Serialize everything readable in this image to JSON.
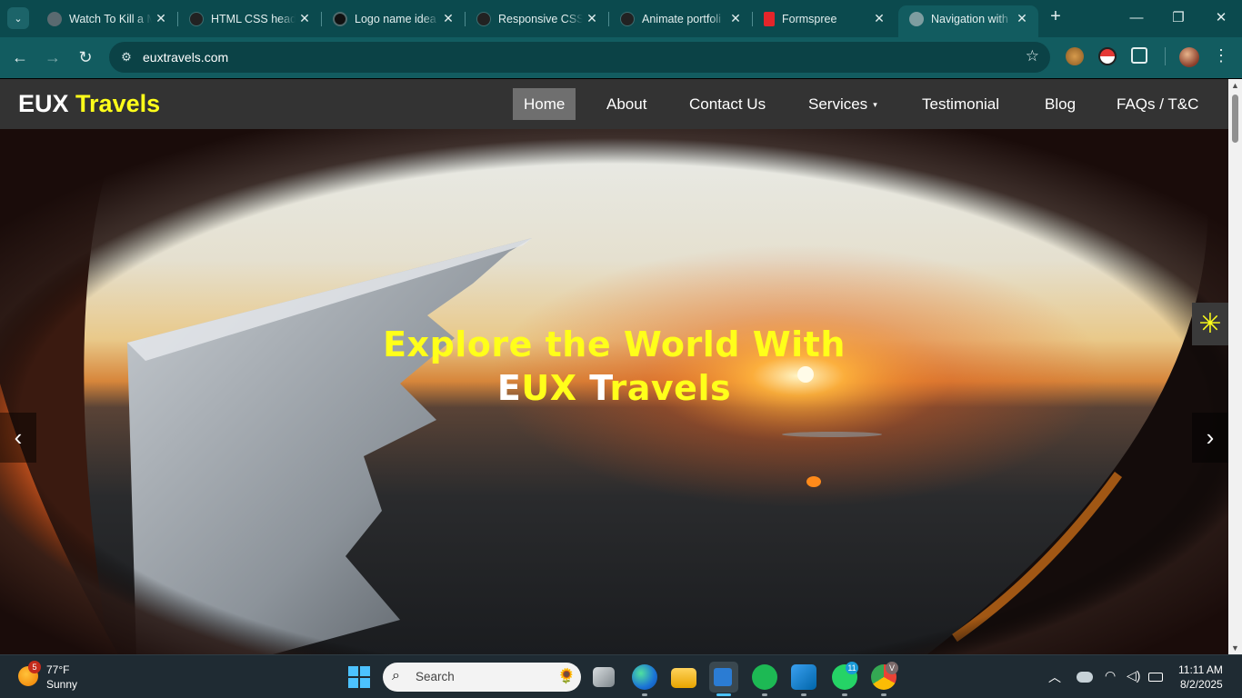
{
  "browser": {
    "tabs": [
      {
        "title": "Watch To Kill a M",
        "favicon_color": "#5a6a70",
        "active": false
      },
      {
        "title": "HTML CSS heade",
        "favicon_color": "#222222",
        "active": false
      },
      {
        "title": "Logo name idea",
        "favicon_color": "#111111",
        "active": false
      },
      {
        "title": "Responsive CSS",
        "favicon_color": "#222222",
        "active": false
      },
      {
        "title": "Animate portfoli",
        "favicon_color": "#222222",
        "active": false
      },
      {
        "title": "Formspree",
        "favicon_color": "#e5252a",
        "active": false
      },
      {
        "title": "Navigation with",
        "favicon_color": "#7e9da0",
        "active": true
      }
    ],
    "url": "euxtravels.com",
    "new_tab_symbol": "+",
    "window_controls": {
      "minimize": "—",
      "restore": "❐",
      "close": "✕"
    }
  },
  "site": {
    "logo": {
      "primary": "EUX",
      "accent": "Travels"
    },
    "nav": [
      {
        "label": "Home",
        "active": true
      },
      {
        "label": "About",
        "active": false
      },
      {
        "label": "Contact Us",
        "active": false
      },
      {
        "label": "Services",
        "active": false,
        "dropdown": true
      },
      {
        "label": "Testimonial",
        "active": false
      },
      {
        "label": "Blog",
        "active": false
      },
      {
        "label": "FAQs / T&C",
        "active": false
      }
    ],
    "hero": {
      "line1": "Explore the World With",
      "line2_white": "E",
      "line2_yellow": "UX",
      "line2_rest_white": "T",
      "line2_rest_yellow": "ravels",
      "prev_symbol": "‹",
      "next_symbol": "›"
    },
    "accent_color": "#ffff1a",
    "nav_bg": "#333333"
  },
  "taskbar": {
    "weather": {
      "temp": "77°F",
      "condition": "Sunny",
      "badge": "5"
    },
    "search_placeholder": "Search",
    "whatsapp_badge": "11",
    "chrome_badge": "V",
    "time": "11:11 AM",
    "date": "8/2/2025"
  }
}
